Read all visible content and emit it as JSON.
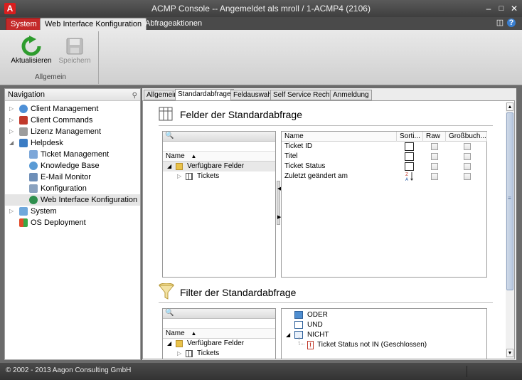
{
  "window": {
    "title": "ACMP Console -- Angemeldet als mroll / 1-ACMP4 (2106)",
    "app_icon": "A"
  },
  "ribbon": {
    "tabs": [
      {
        "label": "System"
      },
      {
        "label": "Web Interface Konfiguration"
      },
      {
        "label": "Abfrageaktionen"
      }
    ],
    "buttons": {
      "refresh": "Aktualisieren",
      "save": "Speichern"
    },
    "group_label": "Allgemein"
  },
  "navigation": {
    "header": "Navigation",
    "items": [
      {
        "label": "Client Management"
      },
      {
        "label": "Client Commands"
      },
      {
        "label": "Lizenz Management"
      },
      {
        "label": "Helpdesk"
      },
      {
        "label": "Ticket Management"
      },
      {
        "label": "Knowledge Base"
      },
      {
        "label": "E-Mail Monitor"
      },
      {
        "label": "Konfiguration"
      },
      {
        "label": "Web Interface Konfiguration"
      },
      {
        "label": "System"
      },
      {
        "label": "OS Deployment"
      }
    ]
  },
  "content_tabs": [
    {
      "label": "Allgemein"
    },
    {
      "label": "Standardabfrage"
    },
    {
      "label": "Feldauswahl"
    },
    {
      "label": "Self Service Rechte"
    },
    {
      "label": "Anmeldung"
    }
  ],
  "fields_section": {
    "title": "Felder der Standardabfrage",
    "tree": {
      "column": "Name",
      "root": "Verfügbare Felder",
      "child": "Tickets"
    },
    "grid": {
      "columns": [
        "Name",
        "Sorti...",
        "Raw",
        "Großbuch..."
      ],
      "rows": [
        {
          "name": "Ticket ID"
        },
        {
          "name": "Titel"
        },
        {
          "name": "Ticket Status"
        },
        {
          "name": "Zuletzt geändert am"
        }
      ]
    }
  },
  "filter_section": {
    "title": "Filter der Standardabfrage",
    "tree": {
      "column": "Name",
      "root": "Verfügbare Felder",
      "child": "Tickets"
    },
    "logic": {
      "or": "ODER",
      "and": "UND",
      "not": "NICHT",
      "condition": "Ticket Status not IN (Geschlossen)"
    }
  },
  "status_bar": {
    "text": "© 2002 - 2013 Aagon Consulting GmbH"
  },
  "colors": {
    "system_tab": "#c42a2a",
    "selection": "#e5e5e5",
    "scroll_thumb": "#b8c8df"
  }
}
